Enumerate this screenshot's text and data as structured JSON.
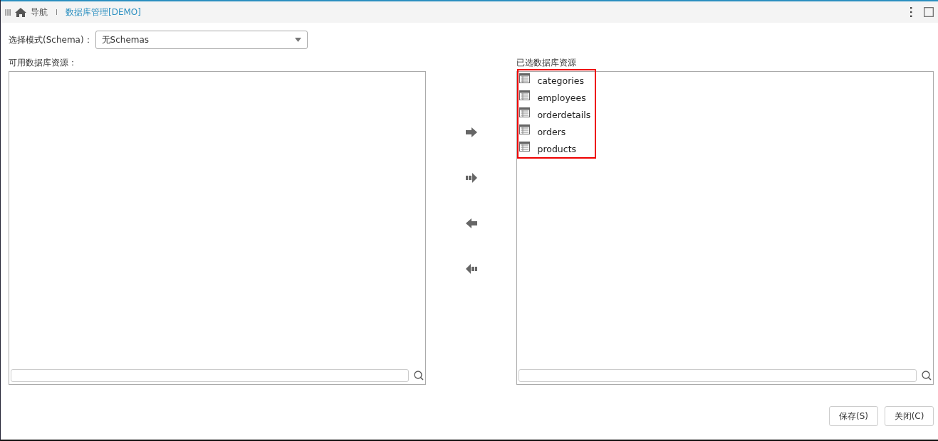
{
  "breadcrumb": {
    "home": "导航",
    "current": "数据库管理[DEMO]"
  },
  "schema": {
    "label": "选择模式(Schema)：",
    "value": "无Schemas"
  },
  "available": {
    "title": "可用数据库资源："
  },
  "selected_resources": {
    "title": "已选数据库资源",
    "items": [
      {
        "label": "categories"
      },
      {
        "label": "employees"
      },
      {
        "label": "orderdetails"
      },
      {
        "label": "orders"
      },
      {
        "label": "products"
      }
    ]
  },
  "buttons": [
    {
      "label": "保存(S)"
    },
    {
      "label": "关闭(C)"
    }
  ]
}
